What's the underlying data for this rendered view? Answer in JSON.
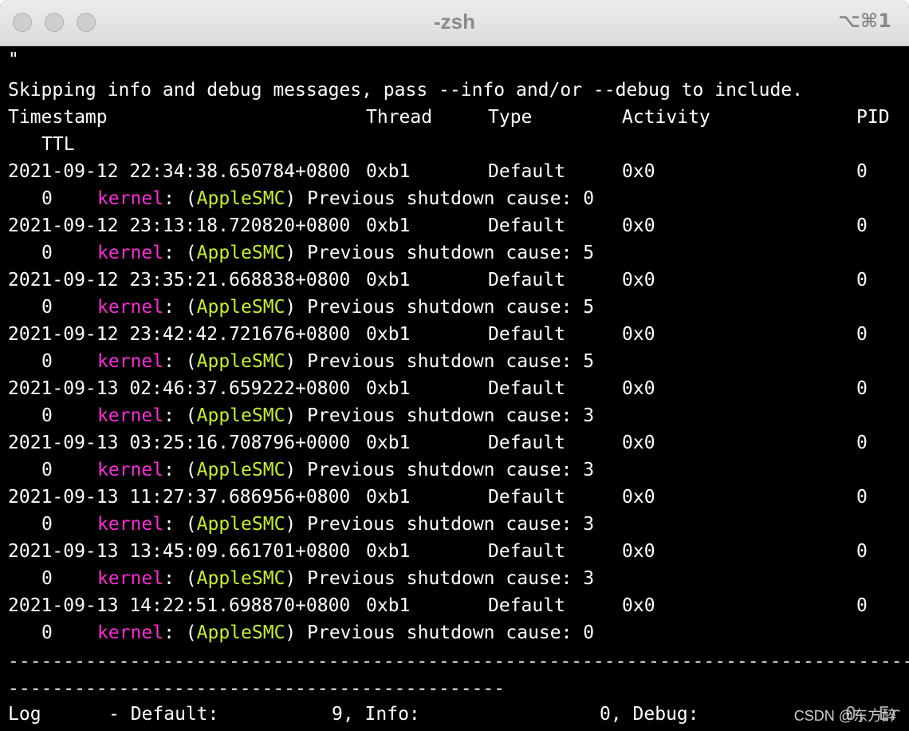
{
  "window": {
    "title": "-zsh",
    "shortcut": "⌥⌘1"
  },
  "terminal": {
    "first_line": "\"",
    "skip_message": "Skipping info and debug messages, pass --info and/or --debug to include.",
    "headers": {
      "timestamp": "Timestamp",
      "thread": "Thread",
      "type": "Type",
      "activity": "Activity",
      "pid": "PID",
      "ttl": "TTL"
    },
    "rows": [
      {
        "timestamp": "2021-09-12 22:34:38.650784+0800",
        "thread": "0xb1",
        "type": "Default",
        "activity": "0x0",
        "pid": "0",
        "ttl": "0",
        "process": "kernel",
        "subsystem": "AppleSMC",
        "message": "Previous shutdown cause: 0"
      },
      {
        "timestamp": "2021-09-12 23:13:18.720820+0800",
        "thread": "0xb1",
        "type": "Default",
        "activity": "0x0",
        "pid": "0",
        "ttl": "0",
        "process": "kernel",
        "subsystem": "AppleSMC",
        "message": "Previous shutdown cause: 5"
      },
      {
        "timestamp": "2021-09-12 23:35:21.668838+0800",
        "thread": "0xb1",
        "type": "Default",
        "activity": "0x0",
        "pid": "0",
        "ttl": "0",
        "process": "kernel",
        "subsystem": "AppleSMC",
        "message": "Previous shutdown cause: 5"
      },
      {
        "timestamp": "2021-09-12 23:42:42.721676+0800",
        "thread": "0xb1",
        "type": "Default",
        "activity": "0x0",
        "pid": "0",
        "ttl": "0",
        "process": "kernel",
        "subsystem": "AppleSMC",
        "message": "Previous shutdown cause: 5"
      },
      {
        "timestamp": "2021-09-13 02:46:37.659222+0800",
        "thread": "0xb1",
        "type": "Default",
        "activity": "0x0",
        "pid": "0",
        "ttl": "0",
        "process": "kernel",
        "subsystem": "AppleSMC",
        "message": "Previous shutdown cause: 3"
      },
      {
        "timestamp": "2021-09-13 03:25:16.708796+0000",
        "thread": "0xb1",
        "type": "Default",
        "activity": "0x0",
        "pid": "0",
        "ttl": "0",
        "process": "kernel",
        "subsystem": "AppleSMC",
        "message": "Previous shutdown cause: 3"
      },
      {
        "timestamp": "2021-09-13 11:27:37.686956+0800",
        "thread": "0xb1",
        "type": "Default",
        "activity": "0x0",
        "pid": "0",
        "ttl": "0",
        "process": "kernel",
        "subsystem": "AppleSMC",
        "message": "Previous shutdown cause: 3"
      },
      {
        "timestamp": "2021-09-13 13:45:09.661701+0800",
        "thread": "0xb1",
        "type": "Default",
        "activity": "0x0",
        "pid": "0",
        "ttl": "0",
        "process": "kernel",
        "subsystem": "AppleSMC",
        "message": "Previous shutdown cause: 3"
      },
      {
        "timestamp": "2021-09-13 14:22:51.698870+0800",
        "thread": "0xb1",
        "type": "Default",
        "activity": "0x0",
        "pid": "0",
        "ttl": "0",
        "process": "kernel",
        "subsystem": "AppleSMC",
        "message": "Previous shutdown cause: 0"
      }
    ],
    "separator_1": "--------------------------------------------------------------------------------------------------",
    "separator_2": "---------------------------------------------",
    "summary": {
      "log_label": "Log",
      "default_label": "- Default:",
      "default_value": "9, Info:",
      "info_value": "0, Debug:",
      "debug_value": "0, Er"
    },
    "colors": {
      "process": "#ff2bd8",
      "subsystem": "#c7ee2c"
    }
  },
  "watermark": "CSDN @东方醉"
}
